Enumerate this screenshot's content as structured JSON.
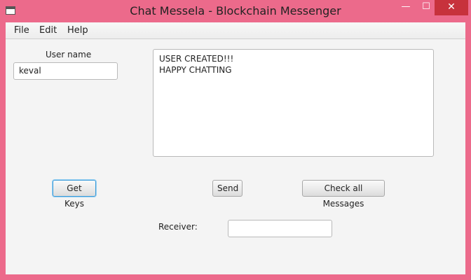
{
  "window": {
    "title": "Chat Messela - Blockchain Messenger",
    "controls": {
      "minimize": "—",
      "maximize": "☐",
      "close": "✕"
    },
    "accent_color": "#ec6a8b",
    "close_color": "#c7323c"
  },
  "menu": {
    "items": [
      {
        "label": "File"
      },
      {
        "label": "Edit"
      },
      {
        "label": "Help"
      }
    ]
  },
  "form": {
    "username_label": "User name",
    "username_value": "keval",
    "message_lines": [
      "USER CREATED!!!",
      "HAPPY CHATTING"
    ],
    "receiver_label": "Receiver:",
    "receiver_value": ""
  },
  "buttons": {
    "get_keys": "Get Keys",
    "send": "Send",
    "check_all": "Check all Messages"
  }
}
